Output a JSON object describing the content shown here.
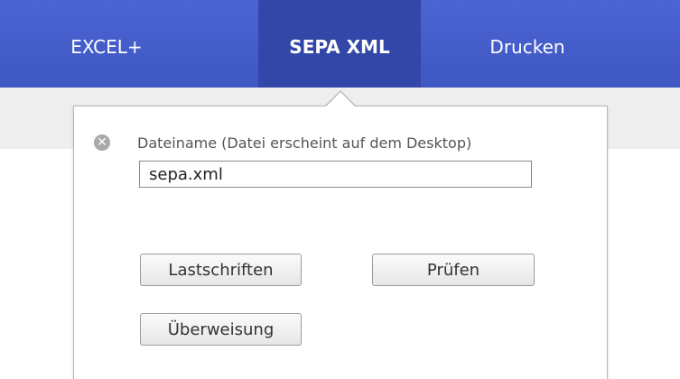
{
  "nav": {
    "tabs": [
      {
        "label": "EXCEL+",
        "active": false
      },
      {
        "label": "SEPA XML",
        "active": true
      },
      {
        "label": "Drucken",
        "active": false
      }
    ],
    "bar_color": "#4a64d2",
    "active_color": "#3347a8"
  },
  "popup": {
    "close_icon": "close-circle-icon",
    "filename_label": "Dateiname (Datei erscheint auf dem Desktop)",
    "filename_value": "sepa.xml",
    "buttons": {
      "lastschriften": "Lastschriften",
      "pruefen": "Prüfen",
      "ueberweisung": "Überweisung"
    }
  }
}
